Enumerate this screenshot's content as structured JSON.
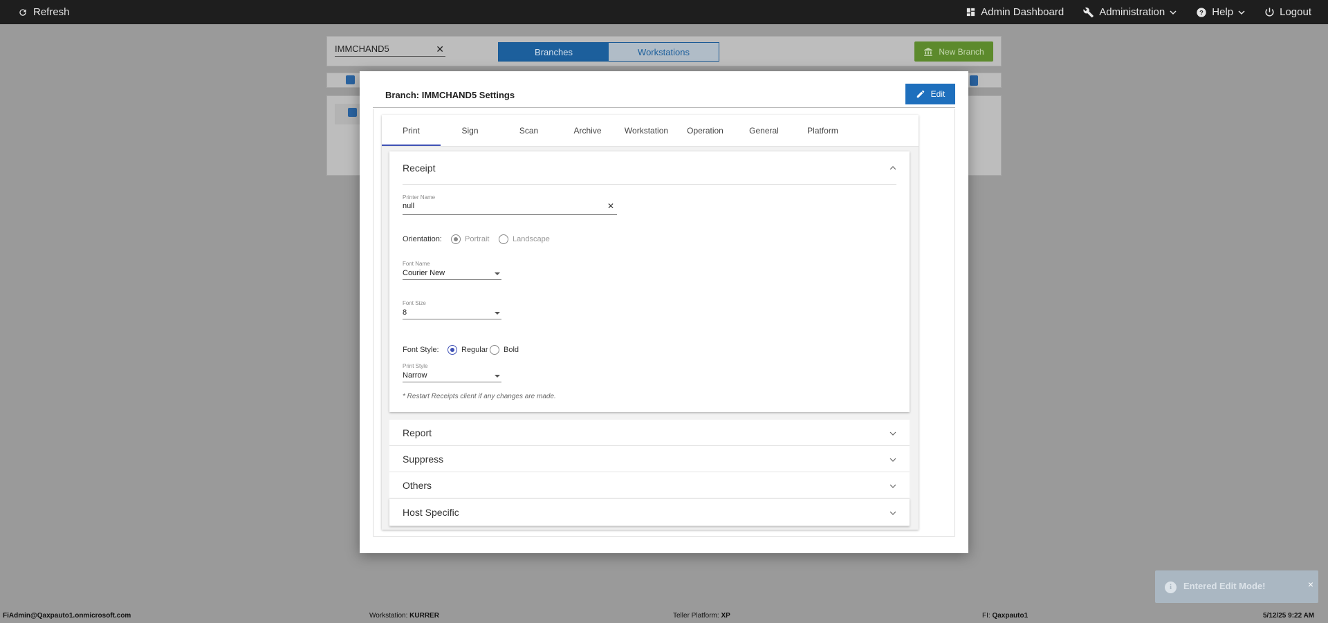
{
  "topbar": {
    "refresh_label": "Refresh",
    "admin_dashboard": "Admin Dashboard",
    "administration": "Administration",
    "help": "Help",
    "logout": "Logout"
  },
  "background": {
    "search_value": "IMMCHAND5",
    "segment": [
      "Branches",
      "Workstations"
    ],
    "new_branch_label": "New Branch"
  },
  "modal": {
    "title": "Branch: IMMCHAND5 Settings",
    "edit_label": "Edit",
    "tabs": [
      "Print",
      "Sign",
      "Scan",
      "Archive",
      "Workstation",
      "Operation",
      "General",
      "Platform"
    ],
    "active_tab": "Print",
    "receipt": {
      "title": "Receipt",
      "printer_name_label": "Printer Name",
      "printer_name_value": "null",
      "orientation_label": "Orientation:",
      "orientation_options": [
        "Portrait",
        "Landscape"
      ],
      "orientation_selected": "Portrait",
      "font_name_label": "Font Name",
      "font_name_value": "Courier New",
      "font_size_label": "Font Size",
      "font_size_value": "8",
      "font_style_label": "Font Style:",
      "font_style_options": [
        "Regular",
        "Bold"
      ],
      "font_style_selected": "Regular",
      "print_style_label": "Print Style",
      "print_style_value": "Narrow",
      "note": "* Restart Receipts client if any changes are made."
    },
    "sections": [
      "Report",
      "Suppress",
      "Others",
      "Host Specific"
    ]
  },
  "toast": {
    "message": "Entered Edit Mode!",
    "close": "×"
  },
  "statusbar": {
    "user": "FiAdmin@Qaxpauto1.onmicrosoft.com",
    "workstation_label": "Workstation:",
    "workstation_value": "KURRER",
    "platform_label": "Teller Platform:",
    "platform_value": "XP",
    "fi_label": "FI:",
    "fi_value": "Qaxpauto1",
    "datetime": "5/12/25 9:22 AM"
  },
  "colors": {
    "topbar": "#1e1e1e",
    "overlay": "#9a9a9a",
    "primary": "#1e6fbd",
    "tab_indicator": "#3f51b5",
    "new_branch": "#5c8a2c"
  }
}
